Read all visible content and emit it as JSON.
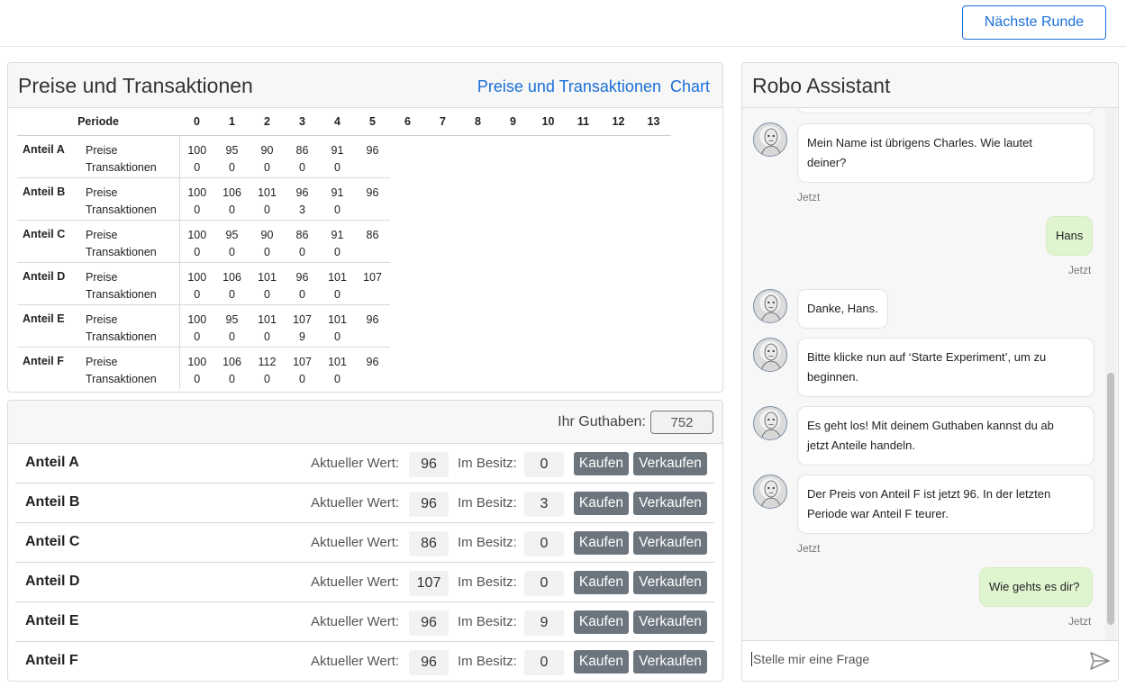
{
  "header": {
    "next_round_label": "Nächste Runde"
  },
  "prices_card": {
    "title": "Preise und Transaktionen",
    "links": [
      "Preise und Transaktionen",
      "Chart"
    ],
    "period_header": "Periode",
    "periods": [
      "0",
      "1",
      "2",
      "3",
      "4",
      "5",
      "6",
      "7",
      "8",
      "9",
      "10",
      "11",
      "12",
      "13"
    ],
    "price_label": "Preise",
    "transactions_label": "Transaktionen",
    "assets": [
      {
        "name": "Anteil A",
        "prices": [
          "100",
          "95",
          "90",
          "86",
          "91",
          "96"
        ],
        "transactions": [
          "0",
          "0",
          "0",
          "0",
          "0"
        ]
      },
      {
        "name": "Anteil B",
        "prices": [
          "100",
          "106",
          "101",
          "96",
          "91",
          "96"
        ],
        "transactions": [
          "0",
          "0",
          "0",
          "3",
          "0"
        ]
      },
      {
        "name": "Anteil C",
        "prices": [
          "100",
          "95",
          "90",
          "86",
          "91",
          "86"
        ],
        "transactions": [
          "0",
          "0",
          "0",
          "0",
          "0"
        ]
      },
      {
        "name": "Anteil D",
        "prices": [
          "100",
          "106",
          "101",
          "96",
          "101",
          "107"
        ],
        "transactions": [
          "0",
          "0",
          "0",
          "0",
          "0"
        ]
      },
      {
        "name": "Anteil E",
        "prices": [
          "100",
          "95",
          "101",
          "107",
          "101",
          "96"
        ],
        "transactions": [
          "0",
          "0",
          "0",
          "9",
          "0"
        ]
      },
      {
        "name": "Anteil F",
        "prices": [
          "100",
          "106",
          "112",
          "107",
          "101",
          "96"
        ],
        "transactions": [
          "0",
          "0",
          "0",
          "0",
          "0"
        ]
      }
    ]
  },
  "trade_card": {
    "balance_label": "Ihr Guthaben:",
    "balance_value": "752",
    "current_value_label": "Aktueller Wert:",
    "holdings_label": "Im Besitz:",
    "buy_label": "Kaufen",
    "sell_label": "Verkaufen",
    "rows": [
      {
        "name": "Anteil A",
        "value": "96",
        "holdings": "0"
      },
      {
        "name": "Anteil B",
        "value": "96",
        "holdings": "3"
      },
      {
        "name": "Anteil C",
        "value": "86",
        "holdings": "0"
      },
      {
        "name": "Anteil D",
        "value": "107",
        "holdings": "0"
      },
      {
        "name": "Anteil E",
        "value": "96",
        "holdings": "9"
      },
      {
        "name": "Anteil F",
        "value": "96",
        "holdings": "0"
      }
    ]
  },
  "chat": {
    "title": "Robo Assistant",
    "messages": [
      {
        "from": "bot",
        "text_lines": [
          "Mein Name ist übrigens Charles. Wie lautet",
          "deiner?"
        ],
        "time": "Jetzt"
      },
      {
        "from": "user",
        "text_lines": [
          "Hans"
        ],
        "time": "Jetzt"
      },
      {
        "from": "bot",
        "text_lines": [
          "Danke, Hans."
        ]
      },
      {
        "from": "bot",
        "text_lines": [
          "Bitte klicke nun auf ‘Starte Experiment’, um zu",
          "beginnen."
        ]
      },
      {
        "from": "bot",
        "text_lines": [
          "Es geht los! Mit deinem Guthaben kannst du ab",
          "jetzt Anteile handeln."
        ]
      },
      {
        "from": "bot",
        "text_lines": [
          "Der Preis von Anteil F ist jetzt 96. In der letzten",
          "Periode war Anteil F teurer."
        ],
        "time": "Jetzt"
      },
      {
        "from": "user",
        "text_lines": [
          "Wie gehts es dir?"
        ],
        "time": "Jetzt"
      }
    ],
    "input_placeholder": "Stelle mir eine Frage",
    "icons": {
      "send": "send-icon",
      "avatar": "robot-avatar-icon"
    }
  }
}
